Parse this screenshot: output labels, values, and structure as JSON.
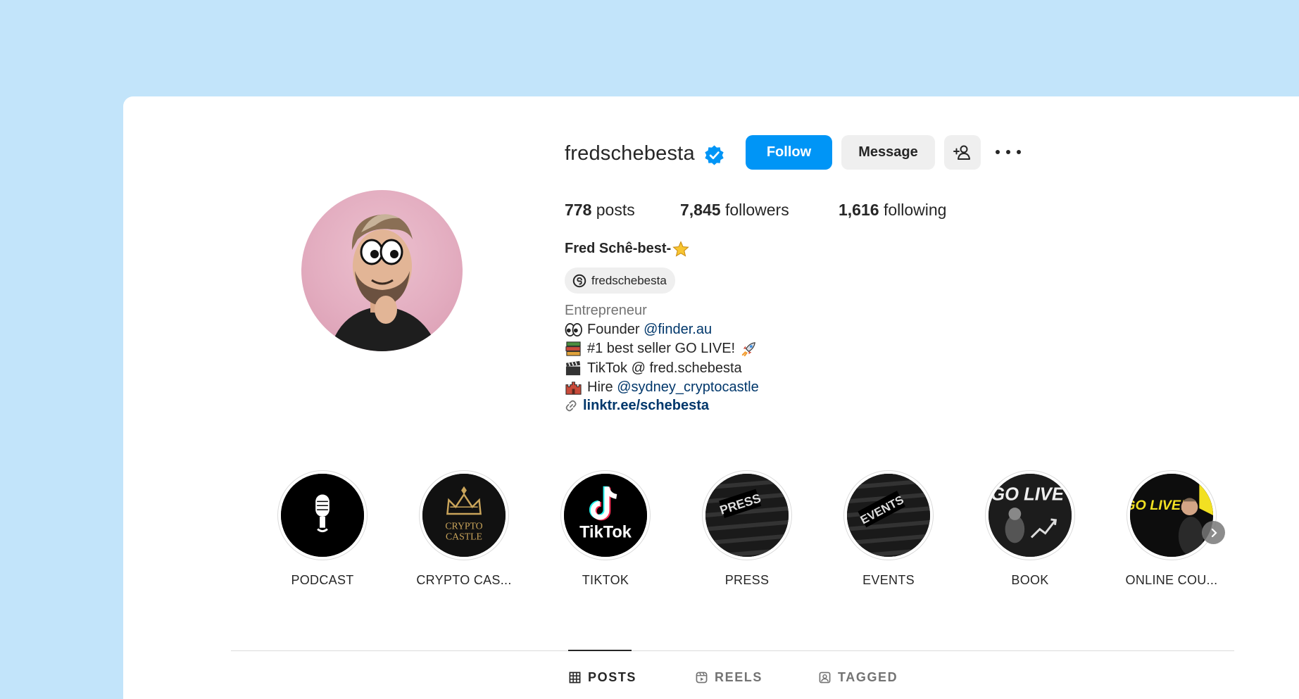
{
  "profile": {
    "username": "fredschebesta",
    "verified": true,
    "follow_label": "Follow",
    "message_label": "Message",
    "stats": {
      "posts_count": "778",
      "posts_label": " posts",
      "followers_count": "7,845",
      "followers_label": " followers",
      "following_count": "1,616",
      "following_label": " following"
    },
    "full_name": "Fred Schê-best-",
    "threads_handle": "fredschebesta",
    "category": "Entrepreneur",
    "bio": {
      "line1_text": "Founder ",
      "line1_mention": "@finder.au",
      "line2_text": "#1 best seller GO LIVE!",
      "line3_text": "TikTok @ fred.schebesta",
      "line4_text": "Hire ",
      "line4_mention": "@sydney_cryptocastle",
      "link": "linktr.ee/schebesta"
    }
  },
  "highlights": [
    {
      "label": "PODCAST",
      "icon": "microphone-icon"
    },
    {
      "label": "CRYPTO CAS...",
      "icon": "crown-icon",
      "cover_text": [
        "CRYPTO",
        "CASTLE"
      ]
    },
    {
      "label": "TIKTOK",
      "icon": "tiktok-icon",
      "cover_text": [
        "TikTok"
      ]
    },
    {
      "label": "PRESS",
      "icon": "press-cover",
      "cover_text": [
        "PRESS"
      ]
    },
    {
      "label": "EVENTS",
      "icon": "events-cover",
      "cover_text": [
        "EVENTS"
      ]
    },
    {
      "label": "BOOK",
      "icon": "book-cover",
      "cover_text": [
        "GO LIVE"
      ]
    },
    {
      "label": "ONLINE COU...",
      "icon": "course-cover",
      "cover_text": [
        "GO LIVE!"
      ]
    }
  ],
  "tabs": [
    {
      "label": "POSTS",
      "icon": "grid-icon",
      "active": true
    },
    {
      "label": "REELS",
      "icon": "reels-icon",
      "active": false
    },
    {
      "label": "TAGGED",
      "icon": "tagged-icon",
      "active": false
    }
  ],
  "colors": {
    "background": "#c2e4fa",
    "follow_button": "#0095f6",
    "verified_badge": "#0095f6",
    "mention": "#00376b",
    "secondary_text": "#737373"
  }
}
